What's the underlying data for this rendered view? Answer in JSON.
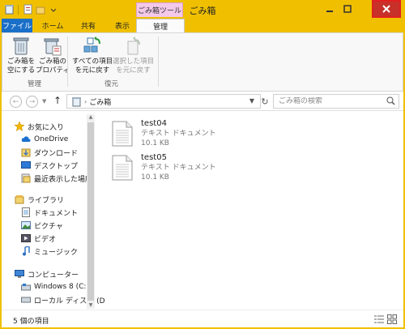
{
  "window": {
    "title": "ごみ箱"
  },
  "ribbon": {
    "context_tab_title": "ごみ箱ツール",
    "tabs": {
      "file": "ファイル",
      "home": "ホーム",
      "share": "共有",
      "view": "表示",
      "manage": "管理"
    },
    "buttons": {
      "empty_bin": "ごみ箱を\n空にする",
      "empty_bin_1": "ごみ箱を",
      "empty_bin_2": "空にする",
      "bin_props_1": "ごみ箱の",
      "bin_props_2": "プロパティ",
      "restore_all_1": "すべての項目",
      "restore_all_2": "を元に戻す",
      "restore_sel_1": "選択した項目",
      "restore_sel_2": "を元に戻す"
    },
    "groups": {
      "manage": "管理",
      "restore": "復元"
    }
  },
  "address": {
    "path": "ごみ箱",
    "search_placeholder": "ごみ箱の検索"
  },
  "nav": {
    "favorites": "お気に入り",
    "onedrive": "OneDrive",
    "downloads": "ダウンロード",
    "desktop": "デスクトップ",
    "recent": "最近表示した場所",
    "libraries": "ライブラリ",
    "documents": "ドキュメント",
    "pictures": "ピクチャ",
    "videos": "ビデオ",
    "music": "ミュージック",
    "computer": "コンピューター",
    "windows8": "Windows 8 (C:)",
    "local_disk": "ローカル ディスク (D"
  },
  "files": [
    {
      "name": "test04",
      "type": "テキスト ドキュメント",
      "size": "10.1 KB"
    },
    {
      "name": "test05",
      "type": "テキスト ドキュメント",
      "size": "10.1 KB"
    }
  ],
  "status": {
    "count": "5 個の項目"
  },
  "colors": {
    "titlebar": "#f0c000",
    "file_tab": "#1a6fc8",
    "context_tab": "#f3c8e8",
    "close_button": "#c7312a"
  }
}
